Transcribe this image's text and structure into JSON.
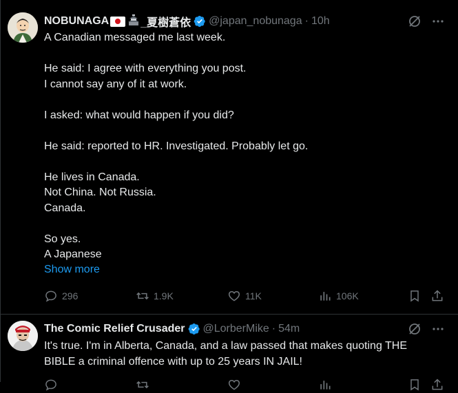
{
  "tweet1": {
    "name": "NOBUNAGA",
    "name_suffix": "_夏樹蒼依",
    "handle": "@japan_nobunaga",
    "separator": "·",
    "time": "10h",
    "lines": [
      "A Canadian messaged me last week.",
      "",
      "He said: I agree with everything you post.",
      "I cannot say any of it at work.",
      "",
      "I asked: what would happen if you did?",
      "",
      "He said: reported to HR. Investigated. Probably let go.",
      "",
      "He lives in Canada.",
      "Not China. Not Russia.",
      "Canada.",
      "",
      "So yes.",
      "A Japanese"
    ],
    "show_more": "Show more",
    "replies": "296",
    "reposts": "1.9K",
    "likes": "11K",
    "views": "106K"
  },
  "tweet2": {
    "name": "The Comic Relief Crusader",
    "handle": "@LorberMike",
    "separator": "·",
    "time": "54m",
    "lines": [
      "It's true. I'm in Alberta, Canada, and a law passed that makes quoting THE",
      "BIBLE a criminal offence with up to 25 years IN JAIL!"
    ]
  },
  "colors": {
    "background": "#000000",
    "text": "#e7e9ea",
    "muted": "#71767b",
    "link": "#1d9bf0",
    "verified": "#1d9bf0",
    "divider": "#2f3336"
  }
}
